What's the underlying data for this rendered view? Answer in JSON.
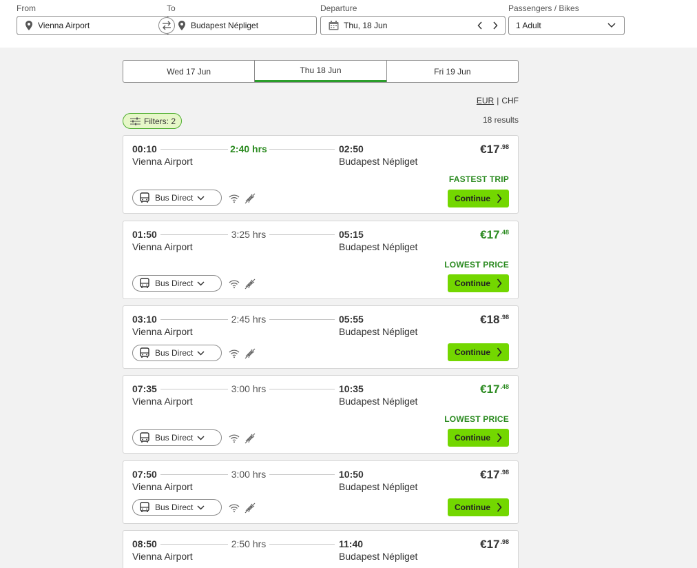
{
  "search": {
    "from_label": "From",
    "from_value": "Vienna Airport",
    "to_label": "To",
    "to_value": "Budapest Népliget",
    "departure_label": "Departure",
    "departure_value": "Thu, 18 Jun",
    "passengers_label": "Passengers / Bikes",
    "passengers_value": "1 Adult"
  },
  "date_tabs": [
    {
      "label": "Wed 17 Jun",
      "active": false
    },
    {
      "label": "Thu 18 Jun",
      "active": true
    },
    {
      "label": "Fri 19 Jun",
      "active": false
    }
  ],
  "currency": {
    "eur": "EUR",
    "separator": "|",
    "chf": "CHF"
  },
  "filters": {
    "label": "Filters: 2"
  },
  "results": {
    "count_text": "18 results"
  },
  "colors": {
    "accent_green": "#73d700",
    "text_green": "#2a8a1f",
    "filter_bg": "#e6f7c8"
  },
  "trips": [
    {
      "dep_time": "00:10",
      "dep_station": "Vienna Airport",
      "duration": "2:40 hrs",
      "arr_time": "02:50",
      "arr_station": "Budapest Népliget",
      "price_main": "€17",
      "price_cents": ".98",
      "badge": "FASTEST TRIP",
      "bus_label": "Bus Direct",
      "continue_label": "Continue",
      "amenities": [
        "wifi-icon",
        "power-plug-icon"
      ]
    },
    {
      "dep_time": "01:50",
      "dep_station": "Vienna Airport",
      "duration": "3:25 hrs",
      "arr_time": "05:15",
      "arr_station": "Budapest Népliget",
      "price_main": "€17",
      "price_cents": ".48",
      "badge": "LOWEST PRICE",
      "bus_label": "Bus Direct",
      "continue_label": "Continue",
      "amenities": [
        "wifi-icon",
        "power-plug-icon"
      ]
    },
    {
      "dep_time": "03:10",
      "dep_station": "Vienna Airport",
      "duration": "2:45 hrs",
      "arr_time": "05:55",
      "arr_station": "Budapest Népliget",
      "price_main": "€18",
      "price_cents": ".98",
      "badge": "",
      "bus_label": "Bus Direct",
      "continue_label": "Continue",
      "amenities": [
        "wifi-icon",
        "power-plug-icon"
      ]
    },
    {
      "dep_time": "07:35",
      "dep_station": "Vienna Airport",
      "duration": "3:00 hrs",
      "arr_time": "10:35",
      "arr_station": "Budapest Népliget",
      "price_main": "€17",
      "price_cents": ".48",
      "badge": "LOWEST PRICE",
      "bus_label": "Bus Direct",
      "continue_label": "Continue",
      "amenities": [
        "wifi-icon",
        "power-plug-icon"
      ]
    },
    {
      "dep_time": "07:50",
      "dep_station": "Vienna Airport",
      "duration": "3:00 hrs",
      "arr_time": "10:50",
      "arr_station": "Budapest Népliget",
      "price_main": "€17",
      "price_cents": ".98",
      "badge": "",
      "bus_label": "Bus Direct",
      "continue_label": "Continue",
      "amenities": [
        "wifi-icon",
        "power-plug-icon"
      ]
    },
    {
      "dep_time": "08:50",
      "dep_station": "Vienna Airport",
      "duration": "2:50 hrs",
      "arr_time": "11:40",
      "arr_station": "Budapest Népliget",
      "price_main": "€17",
      "price_cents": ".98",
      "badge": "",
      "bus_label": "",
      "continue_label": "",
      "amenities": []
    }
  ]
}
